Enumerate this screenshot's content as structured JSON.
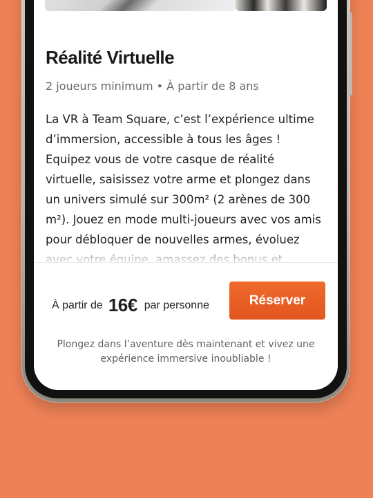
{
  "activity": {
    "title": "Réalité Virtuelle",
    "subtitle": "2 joueurs minimum • À partir de 8 ans",
    "description": "La VR à Team Square, c’est l’expérience ultime d’immersion, accessible à tous les âges ! Equipez vous de votre casque de réalité virtuelle, saisissez votre arme et plongez dans un univers simulé sur 300m² (2 arènes de 300 m²). Jouez en mode multi-joueurs avec vos amis pour débloquer de nouvelles armes, évoluez avec votre équipe, amassez des bonus et découvrez encore bien"
  },
  "booking": {
    "price_prefix": "À partir de",
    "price_amount": "16€",
    "price_suffix": "par personne",
    "reserve_label": "Réserver",
    "tagline": "Plongez dans l’aventure dès maintenant et vivez une expérience immersive inoubliable !"
  },
  "colors": {
    "background": "#EE8156",
    "accent": "#E85D24"
  }
}
